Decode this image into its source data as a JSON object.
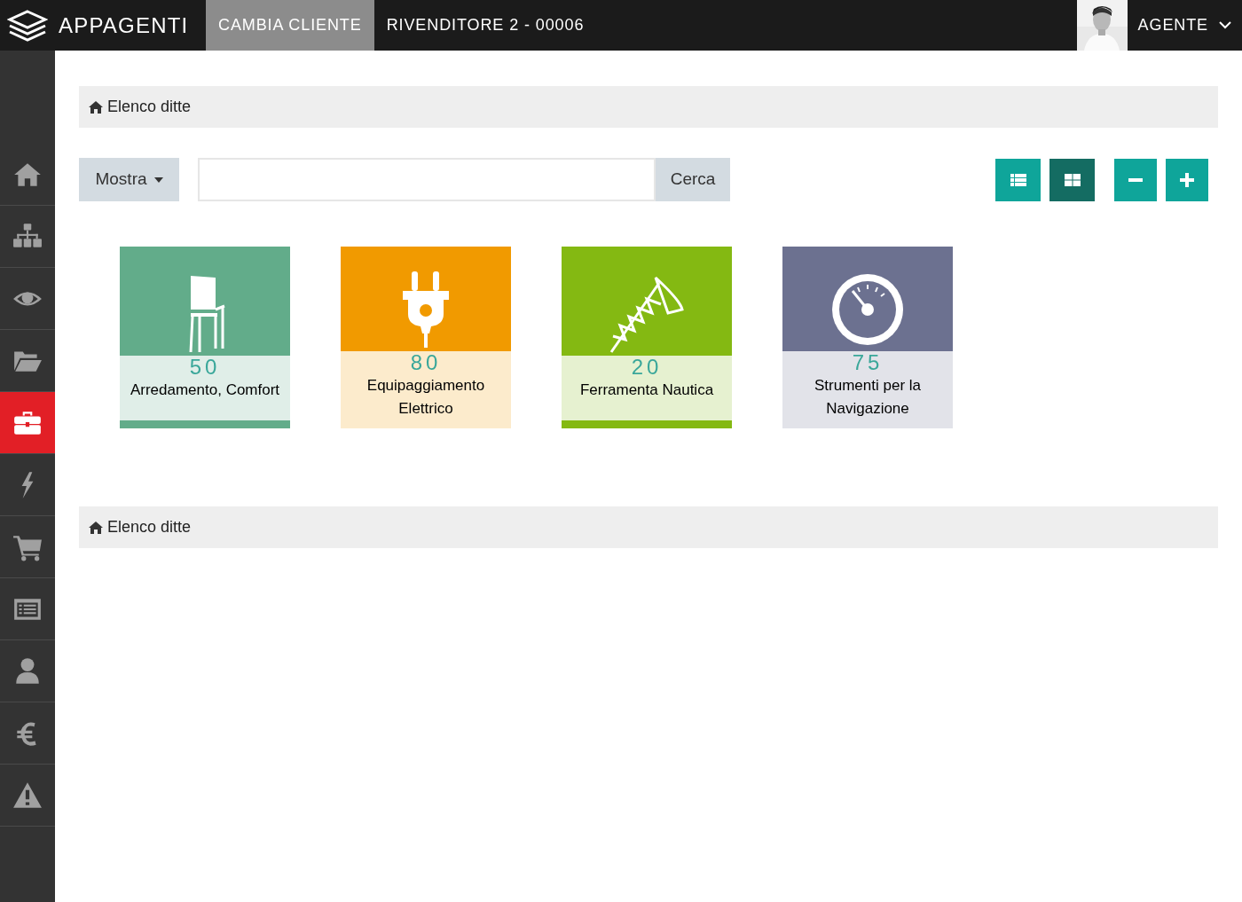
{
  "header": {
    "logo": "APPAGENTI",
    "nav": [
      {
        "label": "CAMBIA CLIENTE",
        "selected": true
      },
      {
        "label": "RIVENDITORE 2 - 00006",
        "selected": false
      }
    ],
    "user": "AGENTE"
  },
  "sidebar": {
    "items": [
      {
        "selected": false
      },
      {
        "selected": false
      },
      {
        "selected": false
      },
      {
        "selected": false
      },
      {
        "selected": true
      },
      {
        "selected": false
      },
      {
        "selected": false
      },
      {
        "selected": false
      },
      {
        "selected": false
      },
      {
        "selected": false
      },
      {
        "selected": false
      }
    ]
  },
  "breadcrumb_top": "Elenco ditte",
  "toolbar": {
    "show_button": "Mostra",
    "search_button": "Cerca",
    "views": [
      {
        "selected": false
      },
      {
        "selected": true
      }
    ]
  },
  "cards": [
    {
      "count": "50",
      "label": "Arredamento, Comfort",
      "color": "#62ac8a",
      "bar": true
    },
    {
      "count": "80",
      "label": "Equipaggiamento Elettrico",
      "color": "#f19a00",
      "bar": false
    },
    {
      "count": "20",
      "label": "Ferramenta Nautica",
      "color": "#84b912",
      "bar": true
    },
    {
      "count": "75",
      "label": "Strumenti per la Navigazione",
      "color": "#6c7190",
      "bar": false
    }
  ],
  "breadcrumb_bottom": "Elenco ditte"
}
